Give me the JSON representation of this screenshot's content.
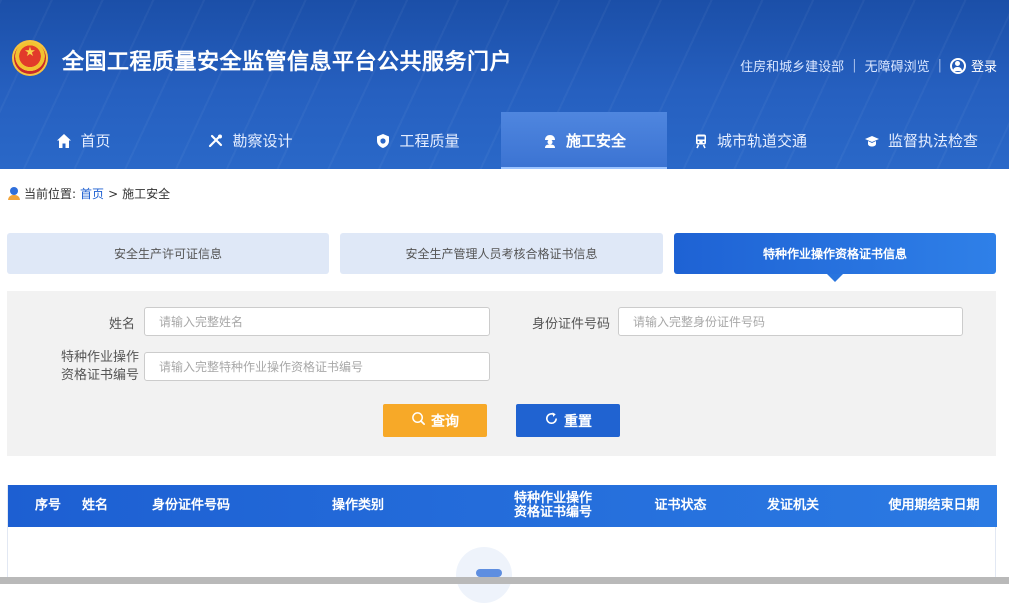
{
  "header": {
    "site_title": "全国工程质量安全监管信息平台公共服务门户",
    "links": {
      "ministry": "住房和城乡建设部",
      "separator": "|",
      "accessible": "无障碍浏览",
      "login": "登录"
    }
  },
  "nav": {
    "items": [
      {
        "label": "首页",
        "icon": "home-icon",
        "active": false
      },
      {
        "label": "勘察设计",
        "icon": "tools-icon",
        "active": false
      },
      {
        "label": "工程质量",
        "icon": "shield-icon",
        "active": false
      },
      {
        "label": "施工安全",
        "icon": "worker-icon",
        "active": true
      },
      {
        "label": "城市轨道交通",
        "icon": "train-icon",
        "active": false
      },
      {
        "label": "监督执法检查",
        "icon": "inspector-icon",
        "active": false
      }
    ]
  },
  "breadcrumb": {
    "prefix": "当前位置:",
    "home": "首页",
    "arrow": ">",
    "current": "施工安全"
  },
  "tabs": [
    {
      "label": "安全生产许可证信息",
      "active": false
    },
    {
      "label": "安全生产管理人员考核合格证书信息",
      "active": false
    },
    {
      "label": "特种作业操作资格证书信息",
      "active": true
    }
  ],
  "form": {
    "name_label": "姓名",
    "name_placeholder": "请输入完整姓名",
    "id_label": "身份证件号码",
    "id_placeholder": "请输入完整身份证件号码",
    "cert_label_line1": "特种作业操作",
    "cert_label_line2": "资格证书编号",
    "cert_placeholder": "请输入完整特种作业操作资格证书编号",
    "query_button": "查询",
    "reset_button": "重置"
  },
  "table": {
    "columns": [
      "序号",
      "姓名",
      "身份证件号码",
      "操作类别",
      "特种作业操作资格证书编号",
      "证书状态",
      "发证机关",
      "使用期结束日期"
    ],
    "cert_col_line1": "特种作业操作",
    "cert_col_line2": "资格证书编号",
    "rows": []
  },
  "colors": {
    "header_blue": "#2660c0",
    "active_tab": "#2874de",
    "query_orange": "#f7a928",
    "reset_blue": "#2063d1"
  }
}
